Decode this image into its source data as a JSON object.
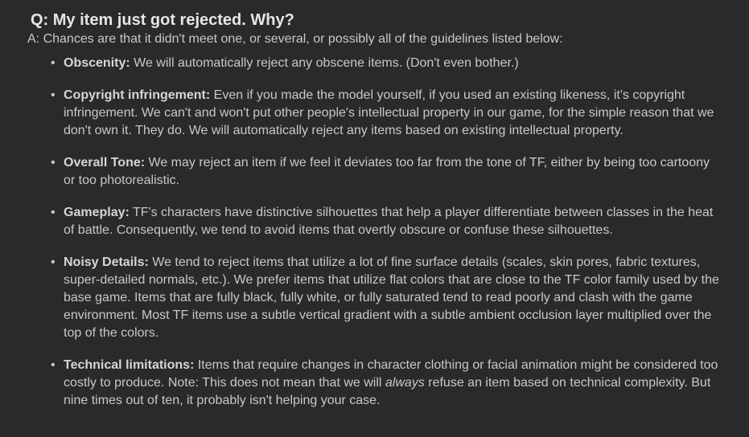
{
  "faq": {
    "question": "Q: My item just got rejected. Why?",
    "answer": "A: Chances are that it didn't meet one, or several, or possibly all of the guidelines listed below:",
    "bullet_glyph": "•",
    "guidelines": [
      {
        "term": "Obscenity:",
        "text": " We will automatically reject any obscene items. (Don't even bother.)"
      },
      {
        "term": "Copyright infringement:",
        "text": " Even if you made the model yourself, if you used an existing likeness, it's copyright infringement. We can't and won't put other people's intellectual property in our game, for the simple reason that we don't own it. They do. We will automatically reject any items based on existing intellectual property."
      },
      {
        "term": "Overall Tone:",
        "text": " We may reject an item if we feel it deviates too far from the tone of TF, either by being too cartoony or too photorealistic."
      },
      {
        "term": "Gameplay:",
        "text": " TF's characters have distinctive silhouettes that help a player differentiate between classes in the heat of battle. Consequently, we tend to avoid items that overtly obscure or confuse these silhouettes."
      },
      {
        "term": "Noisy Details:",
        "text": " We tend to reject items that utilize a lot of fine surface details (scales, skin pores, fabric textures, super-detailed normals, etc.). We prefer items that utilize flat colors that are close to the TF color family used by the base game. Items that are fully black, fully white, or fully saturated tend to read poorly and clash with the game environment. Most TF items use a subtle vertical gradient with a subtle ambient occlusion layer multiplied over the top of the colors."
      },
      {
        "term": "Technical limitations:",
        "text_before": " Items that require changes in character clothing or facial animation might be considered too costly to produce. Note: This does not mean that we will ",
        "emphasis": "always",
        "text_after": " refuse an item based on technical complexity. But nine times out of ten, it probably isn't helping your case."
      }
    ]
  }
}
